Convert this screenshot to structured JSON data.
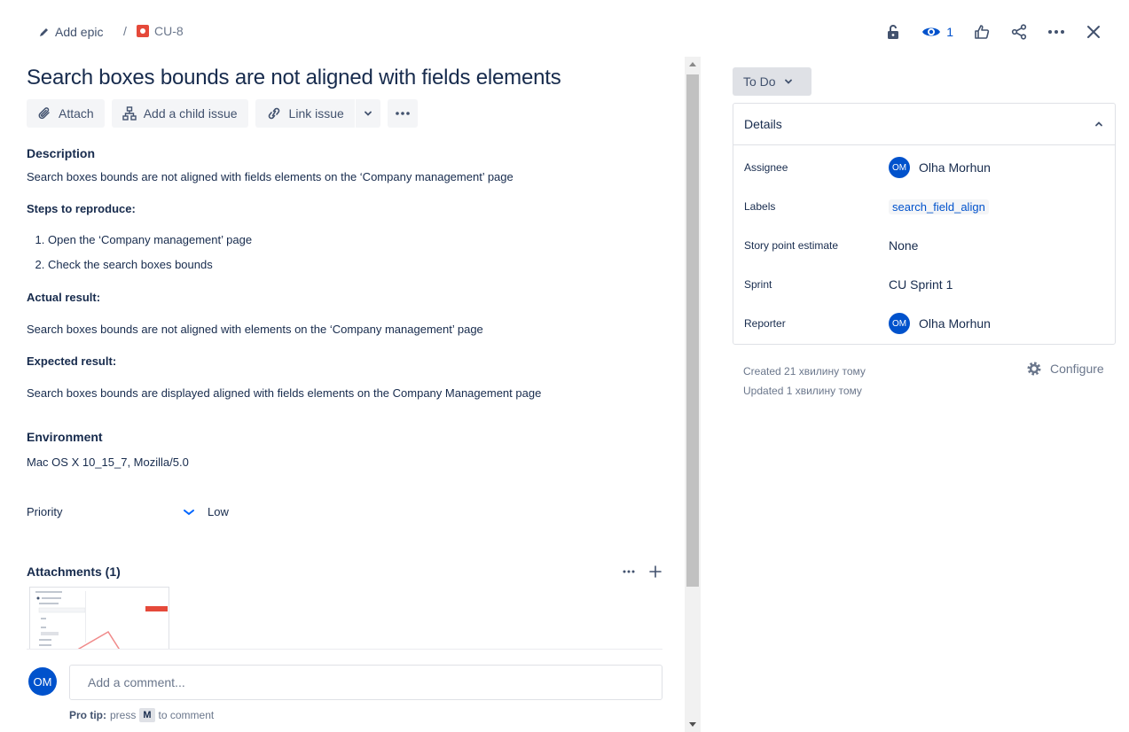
{
  "breadcrumb": {
    "epic_label": "Add epic",
    "separator": "/",
    "issue_key": "CU-8"
  },
  "header_actions": {
    "watch_count": "1"
  },
  "issue": {
    "title": "Search boxes bounds are not aligned with fields elements"
  },
  "toolbar": {
    "attach": "Attach",
    "add_child": "Add a child issue",
    "link_issue": "Link issue"
  },
  "description": {
    "heading": "Description",
    "summary": "Search boxes bounds are not aligned with fields elements on the ‘Company management’ page",
    "steps_heading": "Steps to reproduce:",
    "steps": [
      "Open the ‘Company management’ page",
      "Check the search boxes bounds"
    ],
    "actual_heading": "Actual result:",
    "actual": "Search boxes bounds are not aligned with elements on the ‘Company management’ page",
    "expected_heading": "Expected result:",
    "expected": "Search boxes bounds are displayed aligned with fields elements on the Company Management page"
  },
  "environment": {
    "heading": "Environment",
    "value": "Mac OS X 10_15_7, Mozilla/5.0"
  },
  "priority": {
    "label": "Priority",
    "value": "Low"
  },
  "attachments": {
    "heading": "Attachments (1)"
  },
  "comment": {
    "avatar_initials": "OM",
    "placeholder": "Add a comment...",
    "pro_tip_label": "Pro tip:",
    "pro_tip_press": "press",
    "pro_tip_key": "M",
    "pro_tip_suffix": "to comment"
  },
  "status": {
    "label": "To Do"
  },
  "details": {
    "heading": "Details",
    "assignee_label": "Assignee",
    "assignee_initials": "OM",
    "assignee_name": "Olha Morhun",
    "labels_label": "Labels",
    "labels_value": "search_field_align",
    "story_points_label": "Story point estimate",
    "story_points_value": "None",
    "sprint_label": "Sprint",
    "sprint_value": "CU Sprint 1",
    "reporter_label": "Reporter",
    "reporter_initials": "OM",
    "reporter_name": "Olha Morhun"
  },
  "meta": {
    "created": "Created 21 хвилину тому",
    "updated": "Updated 1 хвилину тому",
    "configure": "Configure"
  },
  "colors": {
    "accent": "#0052cc",
    "text": "#172b4d",
    "bug": "#e5493a"
  }
}
